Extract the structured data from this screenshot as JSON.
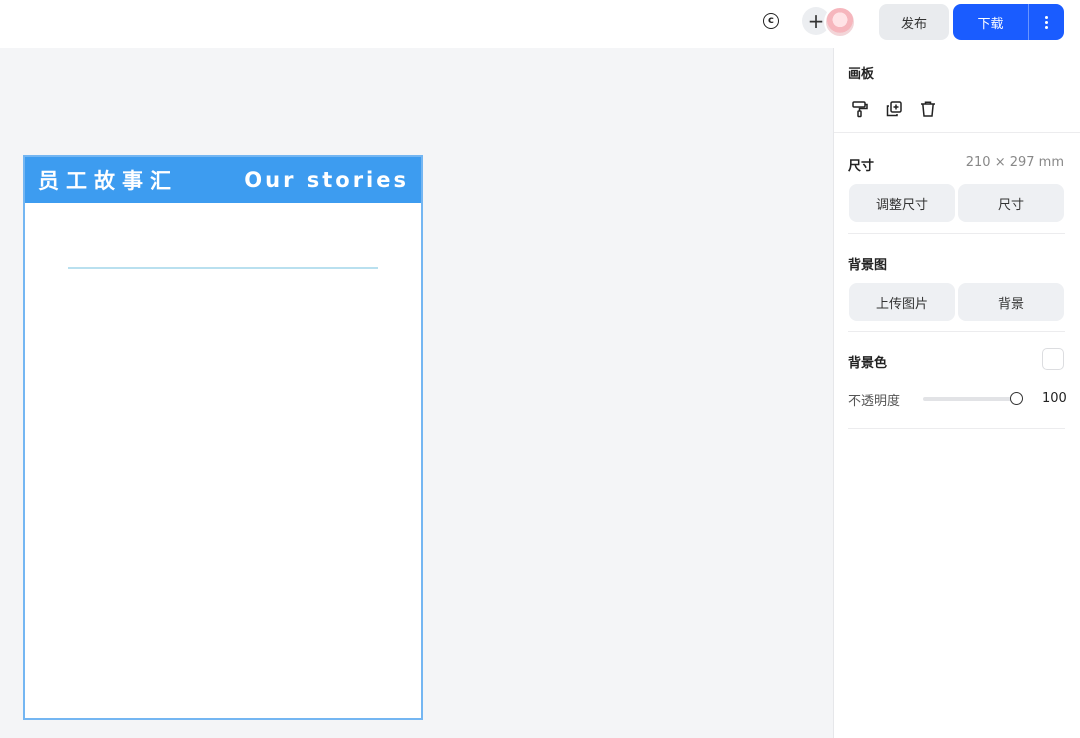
{
  "topbar": {
    "copyright_icon": "copyright-icon",
    "copyright_glyph": "c",
    "add_icon": "plus-icon",
    "add_glyph": "+",
    "publish_label": "发布",
    "download_label": "下载"
  },
  "canvas": {
    "title": "员工故事汇",
    "subtitle": "Our stories",
    "header_color": "#3d9cf0",
    "border_color": "#74b6f2"
  },
  "panel": {
    "artboard_label": "画板",
    "tools": [
      "format-painter-icon",
      "duplicate-icon",
      "delete-icon"
    ],
    "size": {
      "label": "尺寸",
      "value": "210 × 297 mm",
      "resize_button": "调整尺寸",
      "size_button": "尺寸"
    },
    "background_image": {
      "label": "背景图",
      "upload_button": "上传图片",
      "background_button": "背景"
    },
    "background_color": {
      "label": "背景色",
      "swatch_color": "#ffffff",
      "opacity_label": "不透明度",
      "opacity_value": "100"
    }
  },
  "colors": {
    "accent": "#1a5cff"
  }
}
